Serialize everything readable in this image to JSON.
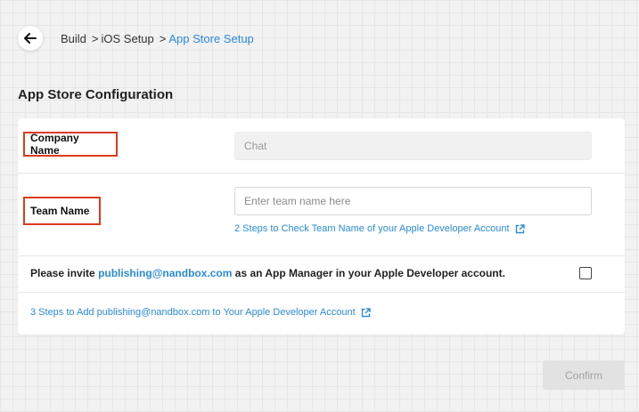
{
  "breadcrumb": {
    "items": [
      {
        "label": "Build"
      },
      {
        "label": "iOS Setup"
      },
      {
        "label": "App Store Setup"
      }
    ],
    "separator": ">"
  },
  "section": {
    "title": "App Store Configuration"
  },
  "form": {
    "company_name": {
      "label": "Company Name",
      "value": "Chat"
    },
    "team_name": {
      "label": "Team Name",
      "placeholder": "Enter team name here",
      "help_link": "2 Steps to Check Team Name of your Apple Developer Account"
    },
    "invite": {
      "prefix": "Please invite",
      "email": "publishing@nandbox.com",
      "suffix": "as an App Manager in your Apple Developer account.",
      "checked": false
    },
    "steps_link": "3 Steps to Add publishing@nandbox.com to Your Apple Developer Account"
  },
  "actions": {
    "confirm_label": "Confirm"
  },
  "icons": {
    "back": "arrow-left-icon",
    "external": "external-link-icon"
  },
  "colors": {
    "accent": "#2a8bd6",
    "highlight": "#d93c1e",
    "disabled_button": "#e2e2e2"
  }
}
